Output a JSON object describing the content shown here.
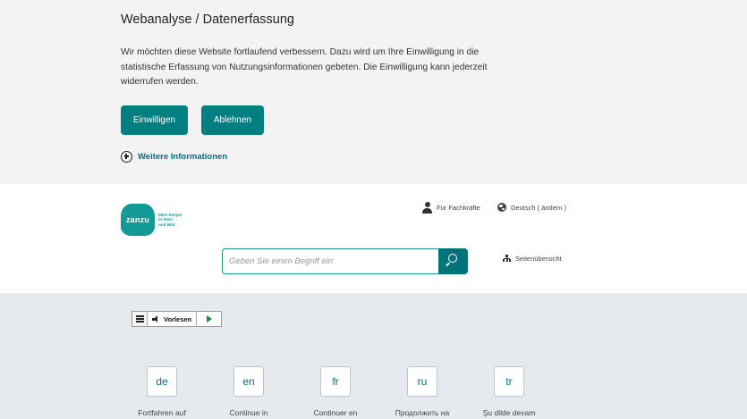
{
  "consent": {
    "title": "Webanalyse / Datenerfassung",
    "text": "Wir möchten diese Website fortlaufend verbessern. Dazu wird um Ihre Einwilligung in die statistische Erfassung von Nutzungsinformationen gebeten. Die Einwilligung kann jederzeit widerrufen werden.",
    "accept_label": "Einwilligen",
    "decline_label": "Ablehnen",
    "more_info_label": "Weitere Informationen"
  },
  "header": {
    "logo_text": "zanzu",
    "logo_tagline": [
      "Mein Körper",
      "in Wort",
      "und Bild"
    ],
    "for_professionals": "Für Fachkräfte",
    "language": "Deutsch ( ändern )",
    "sitemap": "Seitenübersicht",
    "search_placeholder": "Geben Sie einen Begriff ein"
  },
  "readspeaker": {
    "read_label": "Vorlesen"
  },
  "languages": [
    {
      "code": "de",
      "caption": "Fortfahren auf"
    },
    {
      "code": "en",
      "caption": "Continue in"
    },
    {
      "code": "fr",
      "caption": "Continuer en"
    },
    {
      "code": "ru",
      "caption": "Продолжить на"
    },
    {
      "code": "tr",
      "caption": "Şu dilde devam"
    }
  ],
  "colors": {
    "brand_teal": "#007f80",
    "logo_teal": "#139a97",
    "banner_bg": "#f3f3f3",
    "page_bg": "#e6eaee"
  }
}
